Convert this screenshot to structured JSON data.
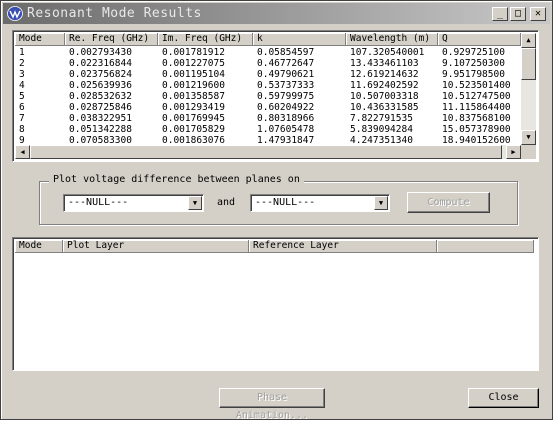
{
  "window": {
    "title": "Resonant Mode Results",
    "minimize_glyph": "_",
    "maximize_glyph": "□",
    "close_glyph": "✕"
  },
  "results_table": {
    "columns": [
      "Mode",
      "Re. Freq (GHz)",
      "Im. Freq (GHz)",
      "k",
      "Wavelength (m)",
      "Q"
    ],
    "rows": [
      [
        "1",
        "0.002793430",
        "0.001781912",
        "0.05854597",
        "107.320540001",
        "0.929725100"
      ],
      [
        "2",
        "0.022316844",
        "0.001227075",
        "0.46772647",
        "13.433461103",
        "9.107250300"
      ],
      [
        "3",
        "0.023756824",
        "0.001195104",
        "0.49790621",
        "12.619214632",
        "9.951798500"
      ],
      [
        "4",
        "0.025639936",
        "0.001219600",
        "0.53737333",
        "11.692402592",
        "10.523501400"
      ],
      [
        "5",
        "0.028532632",
        "0.001358587",
        "0.59799975",
        "10.507003318",
        "10.512747500"
      ],
      [
        "6",
        "0.028725846",
        "0.001293419",
        "0.60204922",
        "10.436331585",
        "11.115864400"
      ],
      [
        "7",
        "0.038322951",
        "0.001769945",
        "0.80318966",
        "7.822791535",
        "10.837568100"
      ],
      [
        "8",
        "0.051342288",
        "0.001705829",
        "1.07605478",
        "5.839094284",
        "15.057378900"
      ],
      [
        "9",
        "0.070583300",
        "0.001863076",
        "1.47931847",
        "4.247351340",
        "18.940152600"
      ]
    ]
  },
  "plot_group": {
    "label": "Plot voltage difference between planes on",
    "combo1_value": "---NULL---",
    "and_label": "and",
    "combo2_value": "---NULL---",
    "compute_label": "Compute"
  },
  "layer_table": {
    "columns": [
      "Mode",
      "Plot Layer",
      "Reference Layer"
    ]
  },
  "footer": {
    "phase_animation_label": "Phase Animation...",
    "close_label": "Close"
  },
  "colors": {
    "titlebar_start": "#6b6b6b",
    "titlebar_end": "#c8c8c8",
    "face": "#d4d0c8"
  }
}
